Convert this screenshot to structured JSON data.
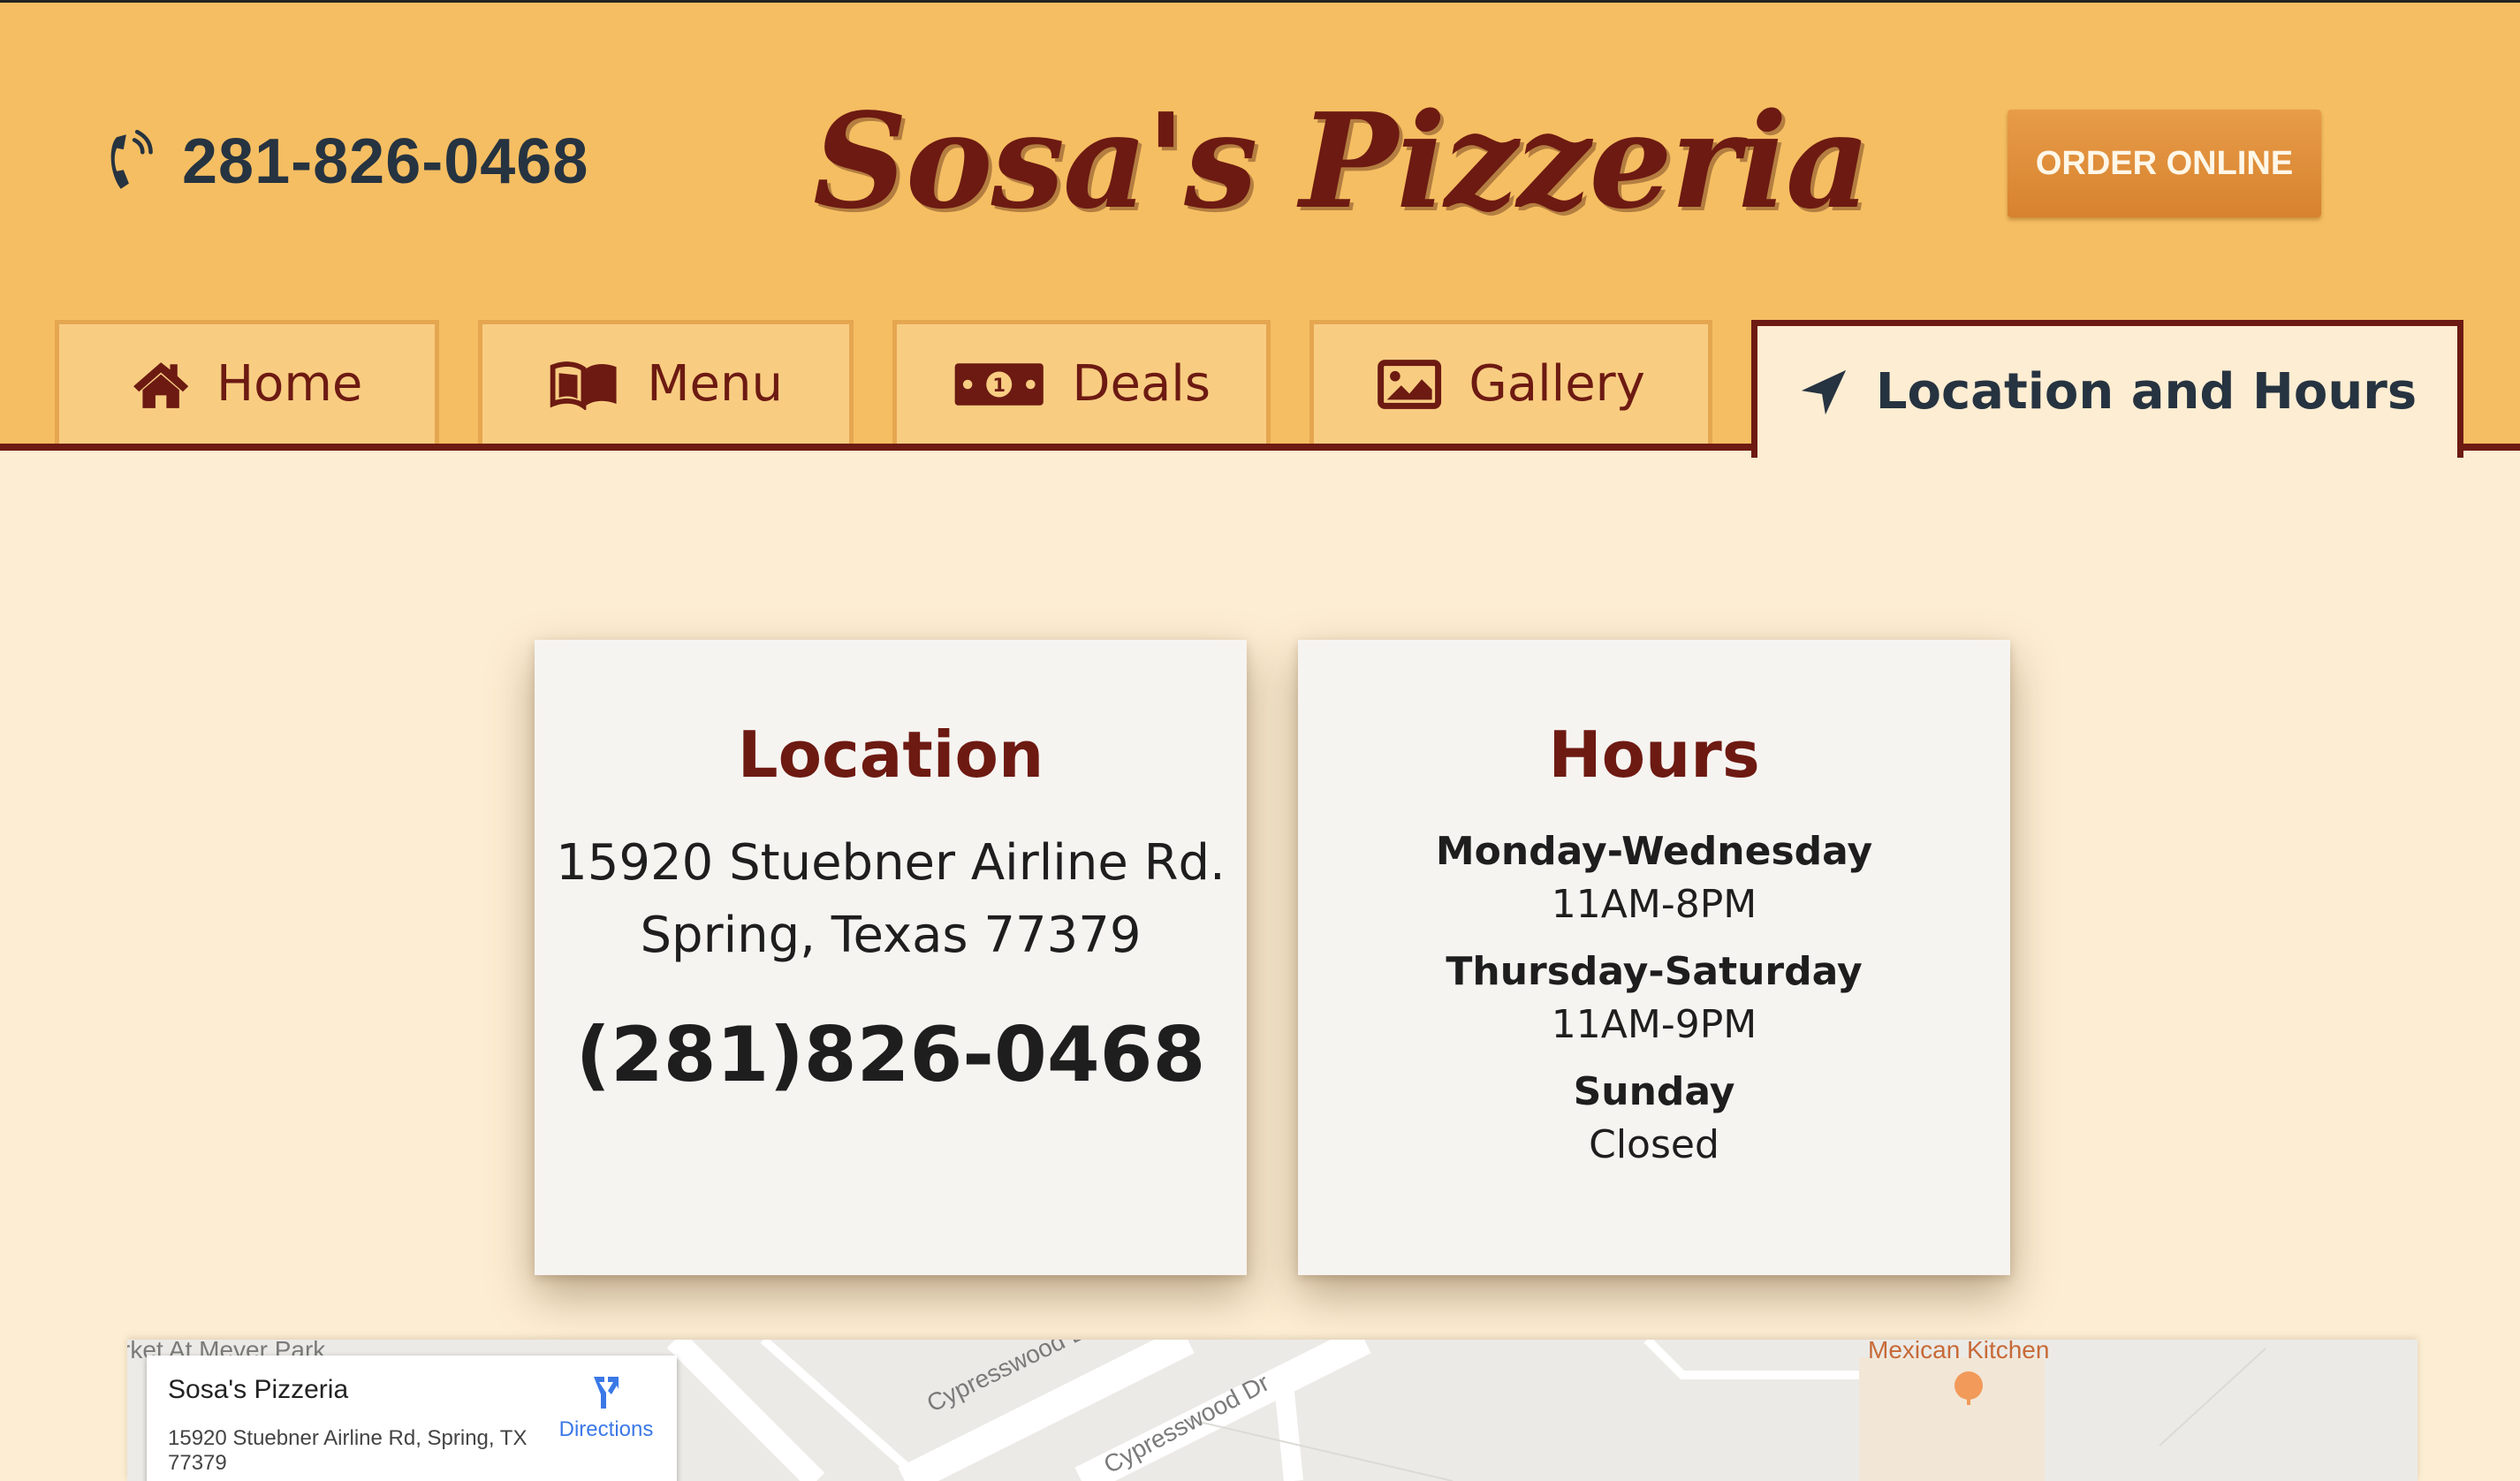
{
  "header": {
    "phone": "281-826-0468",
    "brand": "Sosa's Pizzeria",
    "order_button": "ORDER ONLINE"
  },
  "nav": {
    "tabs": [
      {
        "label": "Home",
        "icon": "home-icon"
      },
      {
        "label": "Menu",
        "icon": "book-icon"
      },
      {
        "label": "Deals",
        "icon": "money-icon"
      },
      {
        "label": "Gallery",
        "icon": "image-icon"
      },
      {
        "label": "Location and Hours",
        "icon": "location-arrow-icon",
        "active": true
      }
    ]
  },
  "location": {
    "title": "Location",
    "address_line1": "15920 Stuebner Airline Rd.",
    "address_line2": "Spring, Texas 77379",
    "phone": "(281)826-0468"
  },
  "hours": {
    "title": "Hours",
    "entries": [
      {
        "day": "Monday-Wednesday",
        "time": "11AM-8PM"
      },
      {
        "day": "Thursday-Saturday",
        "time": "11AM-9PM"
      },
      {
        "day": "Sunday",
        "time": "Closed"
      }
    ]
  },
  "map": {
    "place_name": "Sosa's Pizzeria",
    "place_address": "15920 Stuebner Airline Rd, Spring, TX 77379",
    "directions_label": "Directions",
    "labels": {
      "park": "rket At Meyer Park",
      "street1": "Cypresswood Dr",
      "street2": "Cypresswood Dr",
      "restaurant": "Mexican Kitchen"
    }
  },
  "colors": {
    "header_bg": "#f5be62",
    "brand": "#6d1a12",
    "page_bg": "#fdedd2",
    "order_button": "#df8c3a"
  }
}
